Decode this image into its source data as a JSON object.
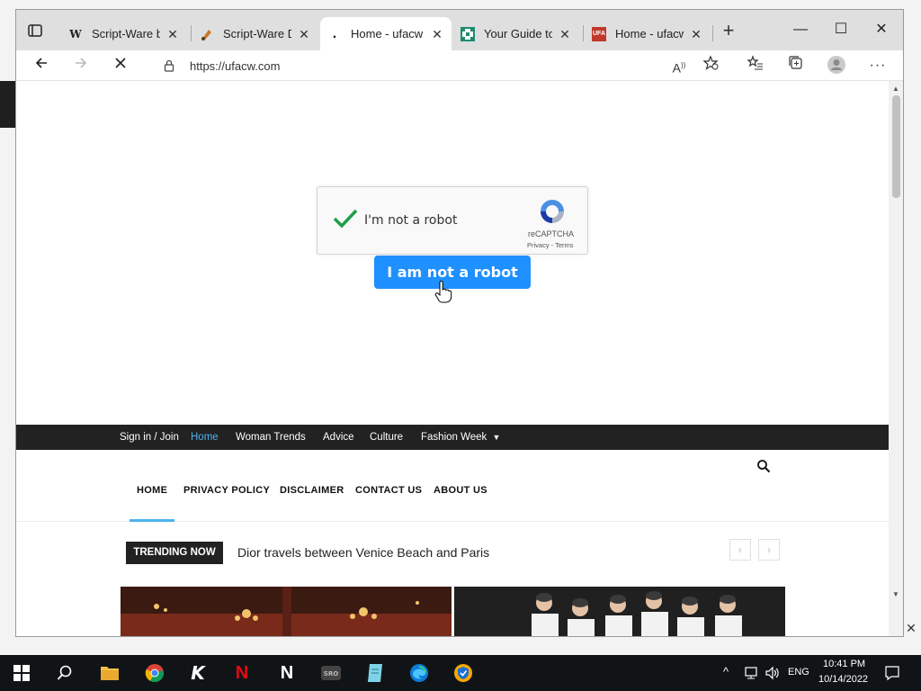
{
  "browser": {
    "tabs": [
      {
        "title": "Script-Ware be",
        "favicon": "W",
        "active": false
      },
      {
        "title": "Script-Ware DC",
        "favicon": "brush",
        "active": false
      },
      {
        "title": "Home - ufacw",
        "favicon": "dot",
        "active": true
      },
      {
        "title": "Your Guide to",
        "favicon": "grid",
        "active": false
      },
      {
        "title": "Home - ufacw",
        "favicon": "ufa",
        "active": false
      }
    ],
    "url": "https://ufacw.com",
    "window_controls": {
      "minimize": "—",
      "maximize": "☐",
      "close": "✕"
    }
  },
  "captcha": {
    "label": "I'm not a robot",
    "brand": "reCAPTCHA",
    "terms": "Privacy - Terms",
    "checked": true
  },
  "robot_button": {
    "label": "I am not a robot"
  },
  "topnav": {
    "items": [
      "Sign in / Join",
      "Home",
      "Woman Trends",
      "Advice",
      "Culture",
      "Fashion Week"
    ],
    "active": "Home"
  },
  "mainnav": {
    "items": [
      "HOME",
      "PRIVACY POLICY",
      "DISCLAIMER",
      "CONTACT US",
      "ABOUT US"
    ]
  },
  "trending": {
    "badge": "TRENDING NOW",
    "headline": "Dior travels between Venice Beach and Paris"
  },
  "taskbar": {
    "lang": "ENG",
    "time": "10:41 PM",
    "date": "10/14/2022"
  },
  "colors": {
    "accent": "#4db2ec",
    "robot_button": "#1e90ff",
    "nav_bg": "#222222"
  }
}
